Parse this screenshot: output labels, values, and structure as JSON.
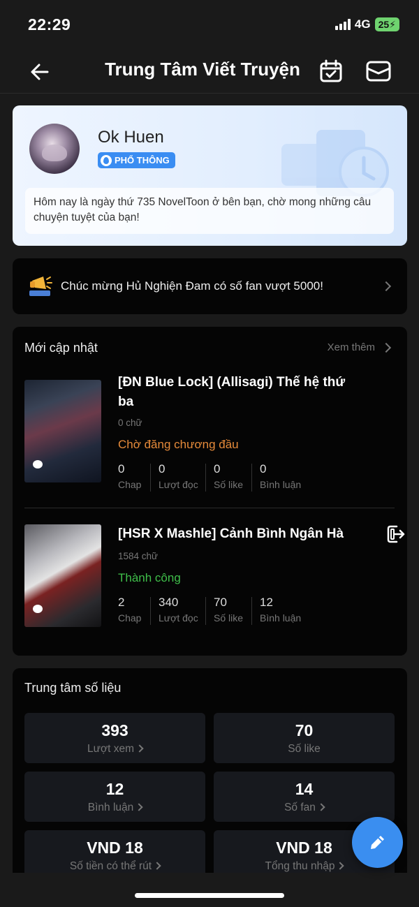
{
  "status_bar": {
    "time": "22:29",
    "network": "4G",
    "battery": "25"
  },
  "nav": {
    "title": "Trung Tâm Viết Truyện",
    "icons": [
      "back-arrow-icon",
      "calendar-check-icon",
      "mail-icon"
    ]
  },
  "profile": {
    "name": "Ok Huen",
    "badge": "PHỔ THÔNG",
    "message": "Hôm nay là ngày thứ 735 NovelToon ở bên bạn, chờ mong những câu chuyện tuyệt của bạn!"
  },
  "notice": {
    "text": "Chúc mừng Hủ Nghiện Đam có số fan vượt 5000!"
  },
  "updates": {
    "title": "Mới cập nhật",
    "see_more": "Xem thêm",
    "stories": [
      {
        "title": "[ĐN Blue Lock] (Allisagi) Thế hệ thứ ba",
        "words": "0 chữ",
        "status": "Chờ đăng chương đầu",
        "status_color": "#e58a3a",
        "stats": [
          {
            "value": "0",
            "label": "Chap"
          },
          {
            "value": "0",
            "label": "Lượt đọc"
          },
          {
            "value": "0",
            "label": "Số like"
          },
          {
            "value": "0",
            "label": "Bình luận"
          }
        ]
      },
      {
        "title": "[HSR X Mashle] Cảnh Bình Ngân Hà",
        "words": "1584 chữ",
        "status": "Thành công",
        "status_color": "#3fbf4a",
        "stats": [
          {
            "value": "2",
            "label": "Chap"
          },
          {
            "value": "340",
            "label": "Lượt đọc"
          },
          {
            "value": "70",
            "label": "Số like"
          },
          {
            "value": "12",
            "label": "Bình luận"
          }
        ]
      }
    ]
  },
  "datacenter": {
    "title": "Trung tâm số liệu",
    "tiles": [
      {
        "value": "393",
        "label": "Lượt xem"
      },
      {
        "value": "70",
        "label": "Số like"
      },
      {
        "value": "12",
        "label": "Bình luận"
      },
      {
        "value": "14",
        "label": "Số fan"
      },
      {
        "value": "VND 18",
        "label": "Số tiền có thể rút"
      },
      {
        "value": "VND 18",
        "label": "Tổng thu nhập"
      }
    ]
  },
  "colors": {
    "accent": "#3a8ef0",
    "card_bg": "#050505",
    "page_bg": "#1a1a1a"
  }
}
